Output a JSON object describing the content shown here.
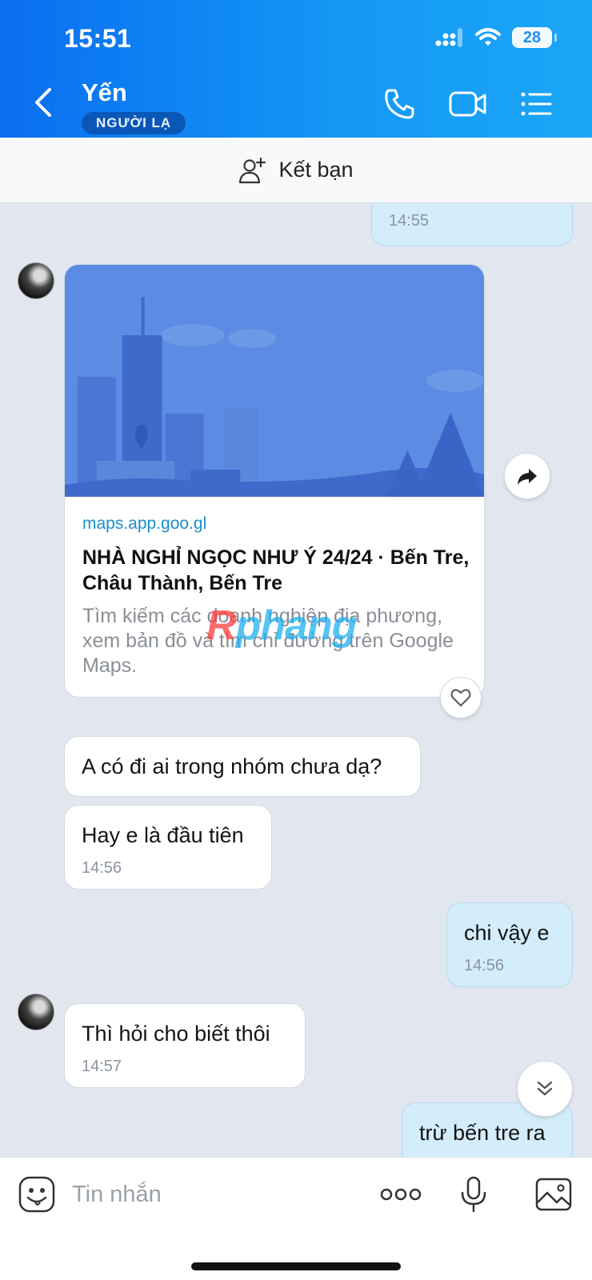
{
  "status_bar": {
    "time": "15:51",
    "battery": "28"
  },
  "header": {
    "contact_name": "Yến",
    "badge": "NGƯỜI LẠ"
  },
  "add_friend": {
    "label": "Kết bạn"
  },
  "messages": {
    "prev_time": "14:55",
    "link_card": {
      "domain": "maps.app.goo.gl",
      "title": "NHÀ NGHỈ NGỌC NHƯ Ý 24/24 · Bến Tre, Châu Thành, Bến Tre",
      "description": "Tìm kiếm các doanh nghiệp địa phương, xem bản đồ và tìm chỉ đường trên Google Maps."
    },
    "m1": {
      "text": "A có đi ai trong nhóm chưa dạ?"
    },
    "m2": {
      "text": "Hay e là đầu tiên",
      "time": "14:56"
    },
    "m3": {
      "text": "chi vậy e",
      "time": "14:56"
    },
    "m4": {
      "text": "Thì hỏi cho biết thôi",
      "time": "14:57"
    },
    "m5": {
      "text": "trừ bến tre ra"
    }
  },
  "watermark": {
    "part1": "R",
    "part2": "phang"
  },
  "input": {
    "placeholder": "Tin nhắn"
  },
  "colors": {
    "header_start": "#0a6ef0",
    "header_end": "#1aa6f6",
    "my_bubble": "#d3edfb",
    "link": "#1a8fc9"
  }
}
